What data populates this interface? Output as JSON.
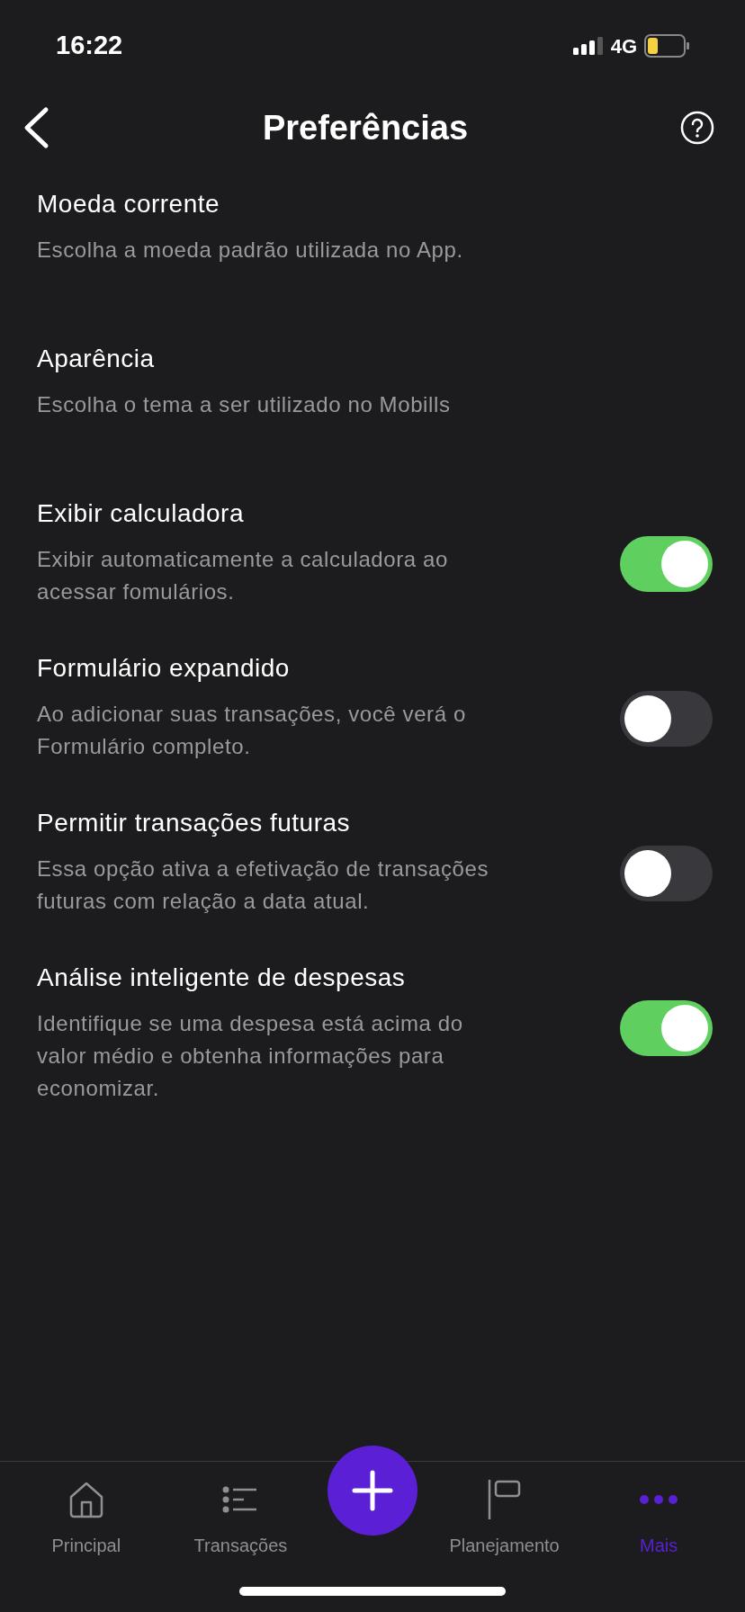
{
  "status_bar": {
    "time": "16:22",
    "network": "4G"
  },
  "header": {
    "title": "Preferências"
  },
  "settings": [
    {
      "kind": "link",
      "title": "Moeda corrente",
      "description": "Escolha a moeda padrão utilizada no App."
    },
    {
      "kind": "link",
      "title": "Aparência",
      "description": "Escolha o tema a ser utilizado no Mobills"
    },
    {
      "kind": "toggle",
      "title": "Exibir calculadora",
      "description": "Exibir automaticamente a calculadora ao acessar fomulários.",
      "on": true
    },
    {
      "kind": "toggle",
      "title": "Formulário expandido",
      "description": "Ao adicionar suas transações, você verá o Formulário completo.",
      "on": false
    },
    {
      "kind": "toggle",
      "title": "Permitir transações futuras",
      "description": "Essa opção ativa a efetivação de transações futuras com relação a data atual.",
      "on": false
    },
    {
      "kind": "toggle",
      "title": "Análise inteligente de despesas",
      "description": "Identifique se uma despesa está acima do valor médio e obtenha informações para economizar.",
      "on": true
    }
  ],
  "tab_bar": [
    {
      "kind": "home",
      "label": "Principal",
      "selected": false
    },
    {
      "kind": "list",
      "label": "Transações",
      "selected": false
    },
    {
      "kind": "add"
    },
    {
      "kind": "flag",
      "label": "Planejamento",
      "selected": false
    },
    {
      "kind": "more",
      "label": "Mais",
      "selected": true
    }
  ]
}
